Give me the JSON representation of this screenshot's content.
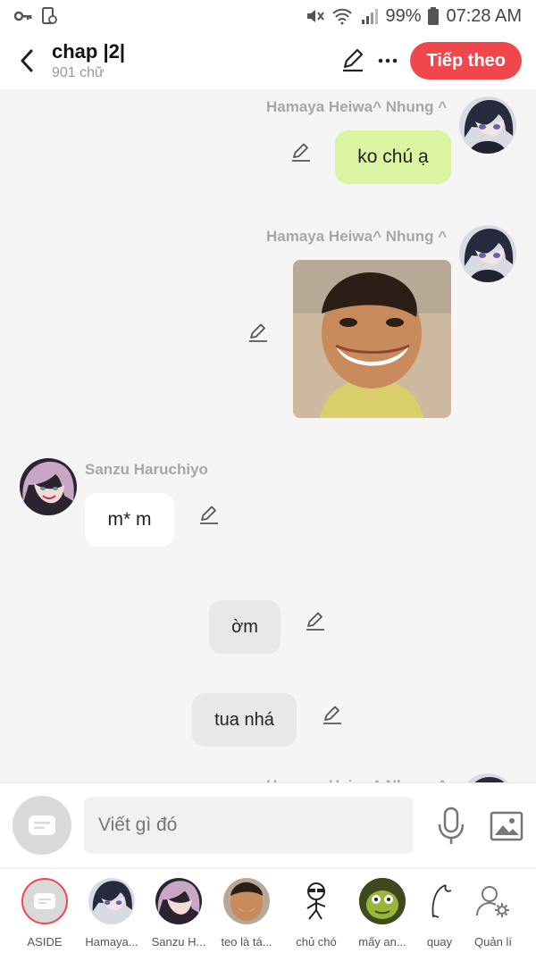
{
  "status_bar": {
    "battery": "99%",
    "time": "07:28 AM"
  },
  "header": {
    "title": "chap |2|",
    "word_count": "901 chữ",
    "next_button": "Tiếp theo"
  },
  "messages": [
    {
      "sender": "Hamaya Heiwa^ Nhung ^",
      "text": "ko chú ạ",
      "side": "right",
      "type": "text"
    },
    {
      "sender": "Hamaya Heiwa^ Nhung ^",
      "text": "",
      "side": "right",
      "type": "image"
    },
    {
      "sender": "Sanzu Haruchiyo",
      "text": "m* m",
      "side": "left",
      "type": "text"
    },
    {
      "sender": "",
      "text": "ờm",
      "side": "center",
      "type": "aside"
    },
    {
      "sender": "",
      "text": "tua nhá",
      "side": "center",
      "type": "aside"
    }
  ],
  "composer": {
    "placeholder": "Viết gì đó"
  },
  "cast_bar": [
    {
      "label": "ASIDE"
    },
    {
      "label": "Hamaya..."
    },
    {
      "label": "Sanzu H..."
    },
    {
      "label": "teo là tá..."
    },
    {
      "label": "chủ chó"
    },
    {
      "label": "mấy an..."
    },
    {
      "label": "quay"
    },
    {
      "label": "Quản lí"
    }
  ],
  "colors": {
    "accent": "#f0474c",
    "own_bubble": "#dcf5a3",
    "other_bubble": "#ffffff",
    "aside_bubble": "#e8e8e8"
  }
}
